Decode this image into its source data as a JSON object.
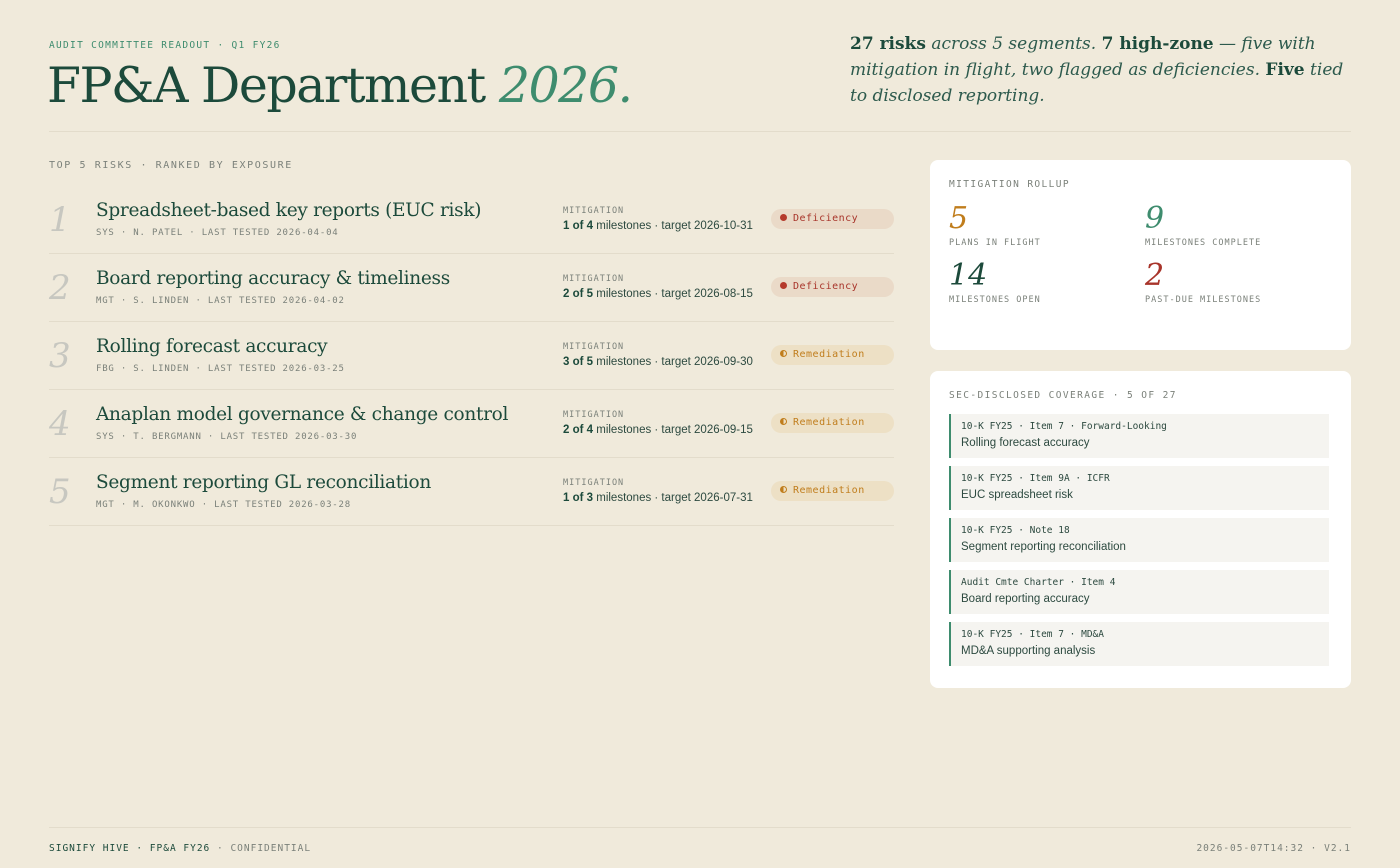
{
  "header": {
    "eyebrow": "AUDIT COMMITTEE READOUT · Q1 FY26",
    "title_main": "FP&A Department",
    "title_year": "2026.",
    "summary": {
      "p1": "27 risks",
      "p2": " across 5 segments. ",
      "p3": "7 high-zone",
      "p4": " — five with mitigation in flight, two flagged as deficiencies. ",
      "p5": "Five",
      "p6": " tied to disclosed reporting."
    }
  },
  "risks": {
    "heading": "TOP 5 RISKS · RANKED BY EXPOSURE",
    "mitigation_label": "MITIGATION",
    "items": [
      {
        "rank": "1",
        "title": "Spreadsheet-based key reports (EUC risk)",
        "meta": "SYS · N. PATEL · LAST TESTED 2026-04-04",
        "progress": "1 of 4",
        "rest": " milestones · target 2026-10-31",
        "status": "Deficiency"
      },
      {
        "rank": "2",
        "title": "Board reporting accuracy & timeliness",
        "meta": "MGT · S. LINDEN · LAST TESTED 2026-04-02",
        "progress": "2 of 5",
        "rest": " milestones · target 2026-08-15",
        "status": "Deficiency"
      },
      {
        "rank": "3",
        "title": "Rolling forecast accuracy",
        "meta": "FBG · S. LINDEN · LAST TESTED 2026-03-25",
        "progress": "3 of 5",
        "rest": " milestones · target 2026-09-30",
        "status": "Remediation"
      },
      {
        "rank": "4",
        "title": "Anaplan model governance & change control",
        "meta": "SYS · T. BERGMANN · LAST TESTED 2026-03-30",
        "progress": "2 of 4",
        "rest": " milestones · target 2026-09-15",
        "status": "Remediation"
      },
      {
        "rank": "5",
        "title": "Segment reporting GL reconciliation",
        "meta": "MGT · M. OKONKWO · LAST TESTED 2026-03-28",
        "progress": "1 of 3",
        "rest": " milestones · target 2026-07-31",
        "status": "Remediation"
      }
    ]
  },
  "rollup": {
    "label": "MITIGATION ROLLUP",
    "stats": [
      {
        "value": "5",
        "label": "PLANS IN FLIGHT",
        "color": "#c07d1c"
      },
      {
        "value": "9",
        "label": "MILESTONES COMPLETE",
        "color": "#3e8c6e"
      },
      {
        "value": "14",
        "label": "MILESTONES OPEN",
        "color": "#1c4a3b"
      },
      {
        "value": "2",
        "label": "PAST-DUE MILESTONES",
        "color": "#a8342a"
      }
    ]
  },
  "coverage": {
    "label": "SEC-DISCLOSED COVERAGE · 5 OF 27",
    "items": [
      {
        "source": "10-K FY25 · Item 7 · Forward-Looking",
        "desc": "Rolling forecast accuracy"
      },
      {
        "source": "10-K FY25 · Item 9A · ICFR",
        "desc": "EUC spreadsheet risk"
      },
      {
        "source": "10-K FY25 · Note 18",
        "desc": "Segment reporting reconciliation"
      },
      {
        "source": "Audit Cmte Charter · Item 4",
        "desc": "Board reporting accuracy"
      },
      {
        "source": "10-K FY25 · Item 7 · MD&A",
        "desc": "MD&A supporting analysis"
      }
    ]
  },
  "footer": {
    "brand": "SIGNIFY HIVE · FP&A FY26",
    "confidential": " · CONFIDENTIAL",
    "stamp": "2026-05-07T14:32 · V2.1"
  }
}
